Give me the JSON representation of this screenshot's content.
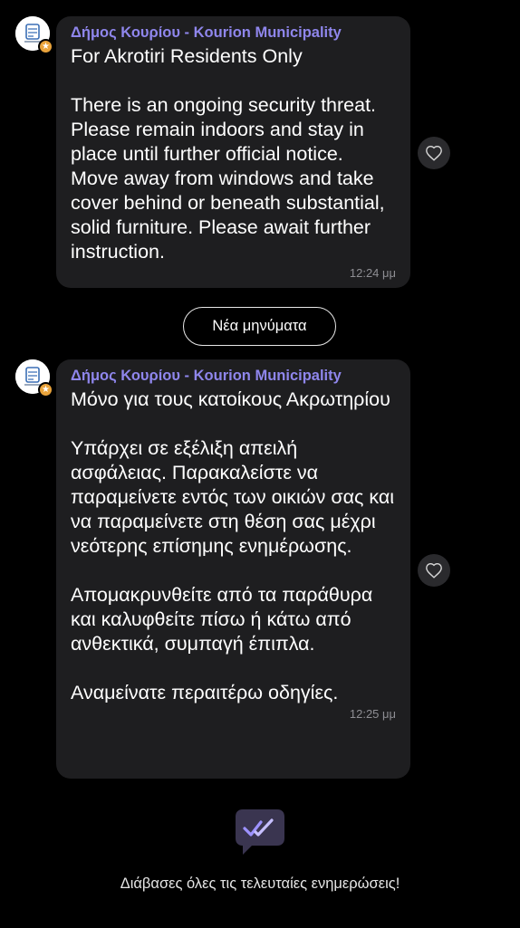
{
  "messages": [
    {
      "sender": "Δήμος Κουρίου - Kourion Municipality",
      "body": "For Akrotiri Residents Only\n\nThere is an ongoing security threat. Please remain indoors and stay in place until further official notice. Move away from windows and take cover behind or beneath substantial, solid furniture. Please await further instruction.",
      "time": "12:24 μμ"
    },
    {
      "sender": "Δήμος Κουρίου - Kourion Municipality",
      "body": "Μόνο για τους κατοίκους Ακρωτηρίου\n\nΥπάρχει σε εξέλιξη απειλή ασφάλειας. Παρακαλείστε να παραμείνετε εντός των οικιών σας και να παραμείνετε στη θέση σας μέχρι νεότερης επίσημης ενημέρωσης.\n\nΑπομακρυνθείτε από τα παράθυρα και καλυφθείτε πίσω ή κάτω από ανθεκτικά, συμπαγή έπιπλα.\n\nΑναμείνατε περαιτέρω οδηγίες.",
      "time": "12:25 μμ"
    }
  ],
  "divider": {
    "new_messages_label": "Νέα μηνύματα"
  },
  "footer": {
    "caught_up_text": "Διάβασες όλες τις τελευταίες ενημερώσεις!",
    "icon": "double-check-bubble-icon"
  },
  "icons": {
    "react": "heart-outline-icon",
    "avatar_badge": "star-badge-icon"
  },
  "colors": {
    "background": "#000000",
    "bubble": "#1e1e20",
    "sender": "#8f86ec",
    "badge": "#e9a33b",
    "footer_icon_bg": "#3a3550",
    "footer_icon_check": "#9d92ff"
  }
}
